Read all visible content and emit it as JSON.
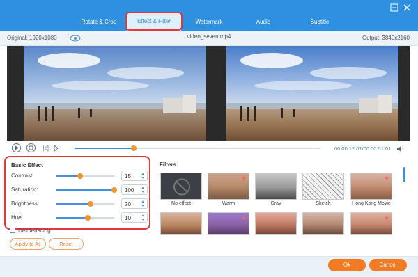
{
  "tabs": [
    {
      "label": "Rotate & Crop"
    },
    {
      "label": "Effect & Filter"
    },
    {
      "label": "Watermark"
    },
    {
      "label": "Audio"
    },
    {
      "label": "Subtitle"
    }
  ],
  "info": {
    "original": "Original: 1920x1080",
    "filename": "video_seven.mp4",
    "output": "Output: 3840x2160"
  },
  "playback": {
    "time": "00:00:12.01/00:00:51.01",
    "progress": 0.24
  },
  "basic_effect": {
    "title": "Basic Effect",
    "sliders": [
      {
        "label": "Contrast:",
        "value": "15",
        "level": 0.42
      },
      {
        "label": "Saturation:",
        "value": "100",
        "level": 1.0
      },
      {
        "label": "Brightness:",
        "value": "20",
        "level": 0.6
      },
      {
        "label": "Hue:",
        "value": "10",
        "level": 0.55
      }
    ]
  },
  "deinterlacing": "Deinterlacing",
  "buttons": {
    "apply_all": "Apply to All",
    "reset": "Reset",
    "ok": "Ok",
    "cancel": "Cancel"
  },
  "filters": {
    "title": "Filters",
    "items": [
      {
        "label": "No effect"
      },
      {
        "label": "Warm"
      },
      {
        "label": "Gray"
      },
      {
        "label": "Sketch"
      },
      {
        "label": "Hong Kong Movie"
      }
    ]
  },
  "colors": {
    "titlebar": "#2f8fe0",
    "accent": "#3a8fd8",
    "orange": "#f37b22",
    "highlight": "#e0383b"
  }
}
